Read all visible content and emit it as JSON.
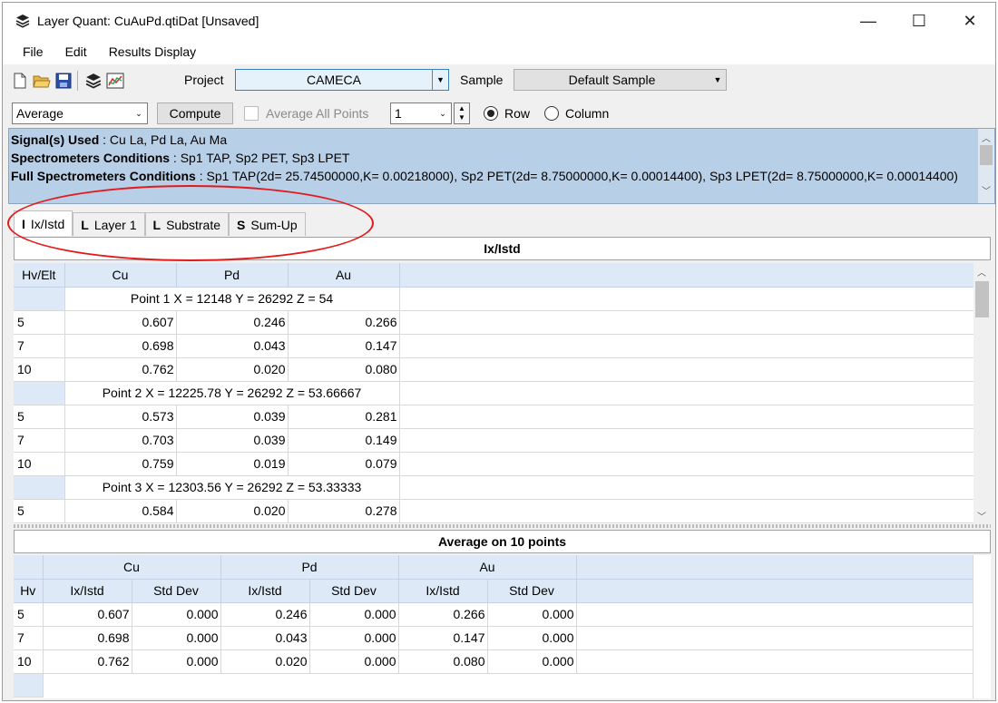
{
  "window": {
    "title": "Layer Quant: CuAuPd.qtiDat [Unsaved]",
    "min": "—",
    "max": "☐",
    "close": "✕"
  },
  "menu": [
    "File",
    "Edit",
    "Results Display"
  ],
  "toolbar": {
    "project_label": "Project",
    "project_value": "CAMECA",
    "sample_label": "Sample",
    "sample_value": "Default Sample",
    "mode_value": "Average",
    "compute_label": "Compute",
    "avg_all_label": "Average All Points",
    "count_value": "1",
    "row_label": "Row",
    "column_label": "Column"
  },
  "info": {
    "signals_key": "Signal(s) Used",
    "signals_val": " : Cu La, Pd La, Au Ma",
    "spec_key": "Spectrometers Conditions",
    "spec_val": " :  Sp1 TAP,  Sp2 PET,  Sp3 LPET",
    "full_key": "Full Spectrometers Conditions",
    "full_val": " :  Sp1 TAP(2d= 25.74500000,K= 0.00218000),  Sp2 PET(2d= 8.75000000,K= 0.00014400),  Sp3 LPET(2d= 8.75000000,K= 0.00014400)"
  },
  "tabs": [
    {
      "icon": "I",
      "label": "Ix/Istd"
    },
    {
      "icon": "L",
      "label": "Layer 1"
    },
    {
      "icon": "L",
      "label": "Substrate"
    },
    {
      "icon": "S",
      "label": "Sum-Up"
    }
  ],
  "top": {
    "title": "Ix/Istd",
    "corner": "Hv/Elt",
    "elements": [
      "Cu",
      "Pd",
      "Au"
    ],
    "points": [
      {
        "label": "Point 1 X = 12148 Y = 26292 Z = 54",
        "rows": [
          [
            "5",
            "0.607",
            "0.246",
            "0.266"
          ],
          [
            "7",
            "0.698",
            "0.043",
            "0.147"
          ],
          [
            "10",
            "0.762",
            "0.020",
            "0.080"
          ]
        ]
      },
      {
        "label": "Point 2 X = 12225.78 Y = 26292 Z = 53.66667",
        "rows": [
          [
            "5",
            "0.573",
            "0.039",
            "0.281"
          ],
          [
            "7",
            "0.703",
            "0.039",
            "0.149"
          ],
          [
            "10",
            "0.759",
            "0.019",
            "0.079"
          ]
        ]
      },
      {
        "label": "Point 3 X = 12303.56 Y = 26292 Z = 53.33333",
        "rows": [
          [
            "5",
            "0.584",
            "0.020",
            "0.278"
          ]
        ]
      }
    ]
  },
  "bottom": {
    "title": "Average on 10 points",
    "corner": "Hv",
    "elements": [
      "Cu",
      "Pd",
      "Au"
    ],
    "sub": [
      "Ix/Istd",
      "Std Dev"
    ],
    "rows": [
      [
        "5",
        "0.607",
        "0.000",
        "0.246",
        "0.000",
        "0.266",
        "0.000"
      ],
      [
        "7",
        "0.698",
        "0.000",
        "0.043",
        "0.000",
        "0.147",
        "0.000"
      ],
      [
        "10",
        "0.762",
        "0.000",
        "0.020",
        "0.000",
        "0.080",
        "0.000"
      ]
    ]
  },
  "colors": {
    "accent": "#b8cfe8",
    "annotation": "#e31a1c",
    "header": "#dde9f6"
  }
}
